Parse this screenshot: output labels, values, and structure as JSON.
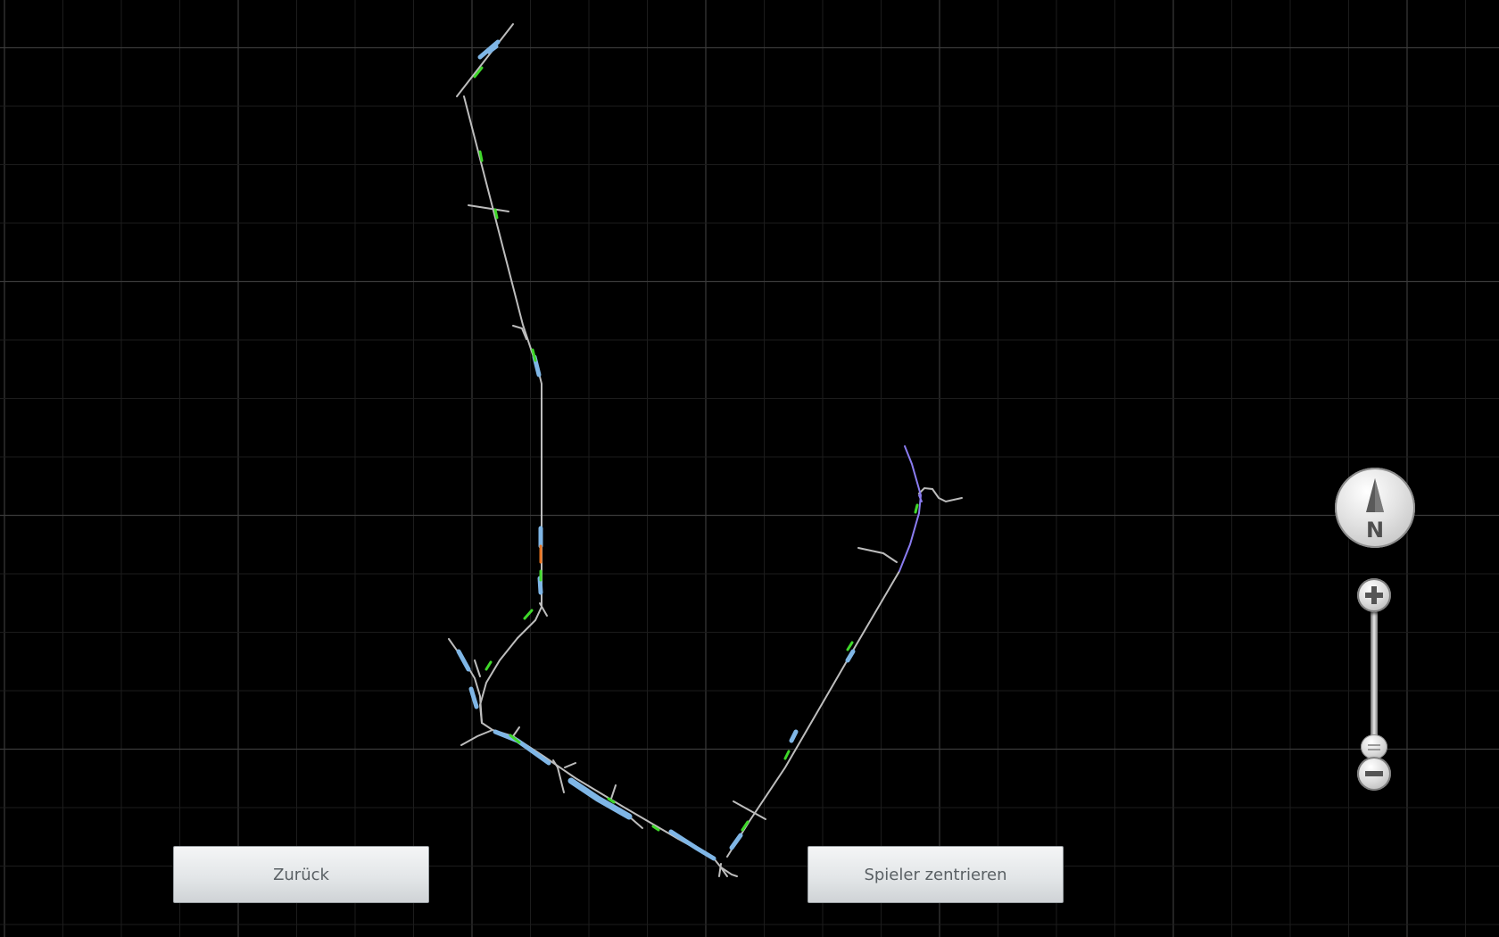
{
  "buttons": {
    "back_label": "Zurück",
    "center_player_label": "Spieler zentrieren"
  },
  "compass": {
    "label": "N",
    "icon": "north-arrow-icon"
  },
  "zoom": {
    "level": 0.85,
    "in_icon": "plus-icon",
    "out_icon": "minus-icon"
  },
  "colors": {
    "background": "#000000",
    "grid_minor": "#1c1c1c",
    "grid_major": "#3a3a3a",
    "track": "#bdbdbd",
    "station": "#7fb6e6",
    "signal_green": "#3fd82a",
    "signal_orange": "#e8721e",
    "route_purple": "#8a7cf0"
  }
}
